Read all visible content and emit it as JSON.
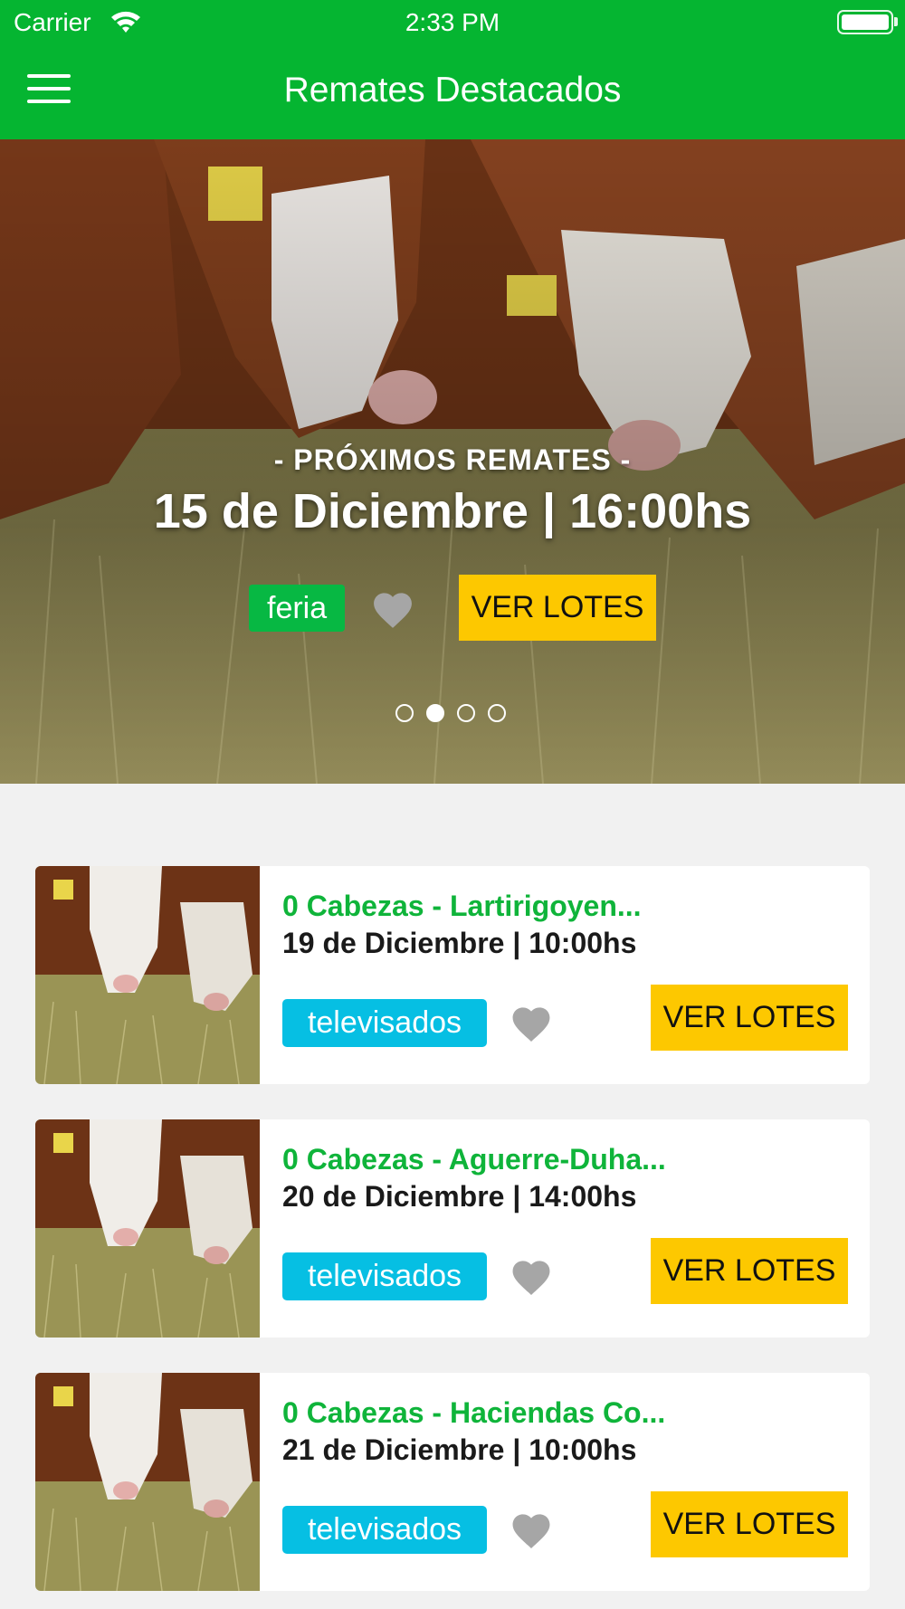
{
  "status_bar": {
    "carrier": "Carrier",
    "time": "2:33 PM"
  },
  "nav": {
    "title": "Remates Destacados",
    "menu_icon": "hamburger-menu-icon"
  },
  "hero": {
    "kicker": "- PRÓXIMOS REMATES -",
    "date": "15 de Diciembre | 16:00hs",
    "tag": "feria",
    "tag_color": "#07b843",
    "button": "VER LOTES",
    "pager_pages": 4,
    "pager_active_index": 1
  },
  "remates": [
    {
      "title": "0 Cabezas - Lartirigoyen...",
      "date": "19 de Diciembre | 10:00hs",
      "tag": "televisados",
      "button": "VER LOTES"
    },
    {
      "title": "0 Cabezas - Aguerre-Duha...",
      "date": "20 de Diciembre | 14:00hs",
      "tag": "televisados",
      "button": "VER LOTES"
    },
    {
      "title": "0 Cabezas - Haciendas Co...",
      "date": "21 de Diciembre | 10:00hs",
      "tag": "televisados",
      "button": "VER LOTES"
    }
  ],
  "colors": {
    "brand_green": "#05b531",
    "title_green": "#0fb43a",
    "tag_cyan": "#06bfe3",
    "button_yellow": "#fdc800",
    "heart_gray": "#a6a6a6",
    "background": "#f1f1f1"
  }
}
